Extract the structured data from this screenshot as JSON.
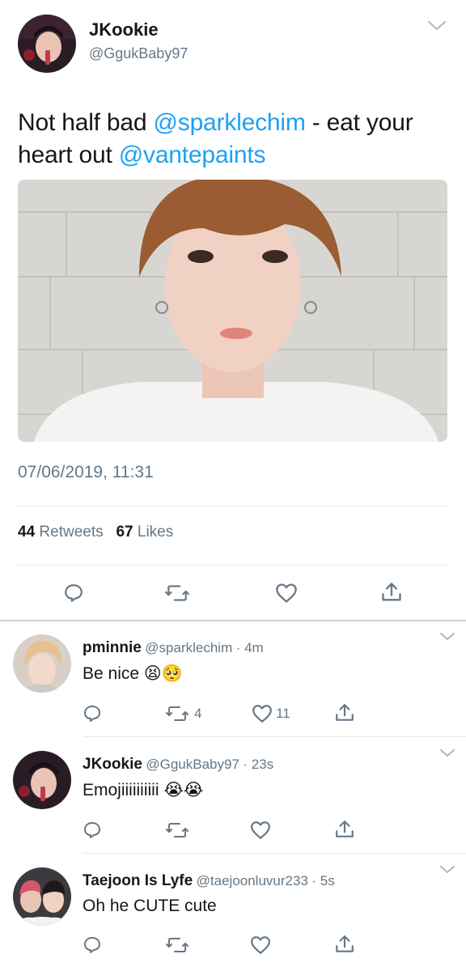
{
  "tweet": {
    "author_name": "JKookie",
    "author_handle": "@GgukBaby97",
    "text_plain_1": "Not half bad ",
    "mention_1": "@sparklechim",
    "text_plain_2": " - eat your heart out ",
    "mention_2": "@vantepaints",
    "timestamp": "07/06/2019, 11:31",
    "retweet_count": "44",
    "retweet_label": "Retweets",
    "like_count": "67",
    "like_label": "Likes"
  },
  "replies": [
    {
      "name": "pminnie",
      "handle": "@sparklechim",
      "time": "· 4m",
      "text": "Be nice 😫🥺",
      "retweets": "4",
      "likes": "11"
    },
    {
      "name": "JKookie",
      "handle": "@GgukBaby97",
      "time": "· 23s",
      "text": "Emojiiiiiiiiii 😭😭",
      "retweets": "",
      "likes": ""
    },
    {
      "name": "Taejoon Is Lyfe",
      "handle": "@taejoonluvur233",
      "time": "· 5s",
      "text": "Oh he CUTE cute",
      "retweets": "",
      "likes": ""
    }
  ],
  "colors": {
    "accent": "#1da1f2",
    "secondary_text": "#657786",
    "divider": "#e1e8ed"
  },
  "icons": [
    "chevron-down-icon",
    "reply-icon",
    "retweet-icon",
    "like-icon",
    "share-icon"
  ]
}
